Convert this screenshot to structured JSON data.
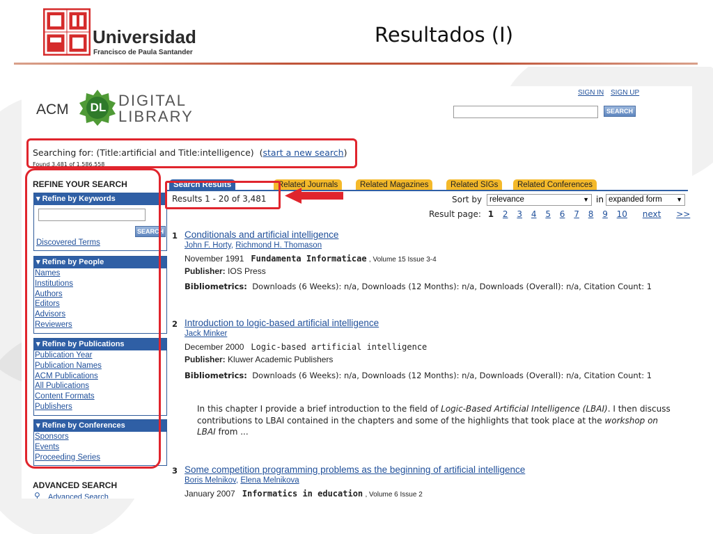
{
  "slide": {
    "logo_word": "Universidad",
    "logo_sub": "Francisco de Paula Santander",
    "title": "Resultados (I)"
  },
  "acm": {
    "acm": "ACM",
    "dl": "DL",
    "digital": "DIGITAL",
    "library": "LIBRARY",
    "sign_in": "SIGN IN",
    "sign_up": "SIGN UP",
    "search_button": "SEARCH"
  },
  "search": {
    "searching_prefix": "Searching for: (Title:artificial and Title:intelligence)",
    "start_new": "start a new search",
    "found": "Found 3,481 of 1,586,558"
  },
  "refine": {
    "title": "REFINE YOUR SEARCH",
    "panels": [
      {
        "head": "Refine by Keywords",
        "links": [
          "Discovered Terms"
        ],
        "button": "SEARCH"
      },
      {
        "head": "Refine by People",
        "links": [
          "Names",
          "Institutions",
          "Authors",
          "Editors",
          "Advisors",
          "Reviewers"
        ]
      },
      {
        "head": "Refine by Publications",
        "links": [
          "Publication Year",
          "Publication Names",
          "ACM Publications",
          "All Publications",
          "Content Formats",
          "Publishers"
        ]
      },
      {
        "head": "Refine by Conferences",
        "links": [
          "Sponsors",
          "Events",
          "Proceeding Series"
        ]
      }
    ]
  },
  "advanced": {
    "title": "ADVANCED SEARCH",
    "link": "Advanced Search"
  },
  "tabs": [
    "Search Results",
    "Related Journals",
    "Related Magazines",
    "Related SIGs",
    "Related Conferences"
  ],
  "results_header": {
    "count": "Results 1 - 20 of 3,481",
    "sort_label": "Sort by",
    "sort_value": "relevance",
    "in_label": "in",
    "form_value": "expanded form",
    "page_label": "Result page:",
    "current_page": "1",
    "pages": [
      "2",
      "3",
      "4",
      "5",
      "6",
      "7",
      "8",
      "9",
      "10"
    ],
    "next": "next",
    "last": ">>"
  },
  "results": [
    {
      "num": "1",
      "title": "Conditionals and artificial intelligence",
      "authors": [
        "John F. Horty",
        "Richmond H. Thomason"
      ],
      "date": "November 1991",
      "publication": "Fundamenta Informaticae",
      "volume": ", Volume 15 Issue 3-4",
      "publisher_label": "Publisher:",
      "publisher": "IOS Press",
      "biblio_label": "Bibliometrics:",
      "biblio": "Downloads (6 Weeks): n/a,  Downloads (12 Months): n/a,  Downloads (Overall): n/a,  Citation Count: 1"
    },
    {
      "num": "2",
      "title": "Introduction to logic-based artificial intelligence",
      "authors": [
        "Jack Minker"
      ],
      "date": "December 2000",
      "publication": "Logic-based artificial intelligence",
      "publisher_label": "Publisher:",
      "publisher": "Kluwer Academic Publishers",
      "biblio_label": "Bibliometrics:",
      "biblio": "Downloads (6 Weeks): n/a,  Downloads (12 Months): n/a,  Downloads (Overall): n/a,  Citation Count: 1",
      "abstract_1": "In this chapter I provide a brief introduction to the field of ",
      "abstract_em1": "Logic-Based Artificial Intelligence (LBAI)",
      "abstract_2": ". I then discuss contributions to LBAI contained in the chapters and some of the highlights that took place at the ",
      "abstract_em2": "workshop on LBAI",
      "abstract_3": " from ..."
    },
    {
      "num": "3",
      "title": "Some competition programming problems as the beginning of artificial intelligence",
      "authors": [
        "Boris Melnikov",
        "Elena Melnikova"
      ],
      "date": "January 2007",
      "publication": "Informatics in education",
      "volume": ", Volume 6 Issue 2"
    }
  ],
  "colors": {
    "accent_red": "#e0252d",
    "acm_blue": "#2f5fa5",
    "tab_orange": "#f4b92a",
    "link_blue": "#1f4f9a"
  }
}
